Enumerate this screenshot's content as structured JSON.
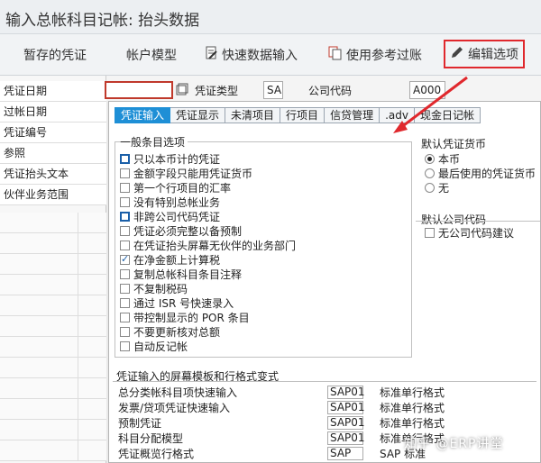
{
  "window": {
    "title": "输入总帐科目记帐: 抬头数据"
  },
  "toolbar": {
    "parked_label": "暂存的凭证",
    "account_model_label": "帐户模型",
    "fast_entry_label": "快速数据输入",
    "reference_label": "使用参考过账",
    "edit_options_label": "编辑选项"
  },
  "left_panel": {
    "items": [
      "凭证日期",
      "过帐日期",
      "凭证编号",
      "参照",
      "凭证抬头文本",
      "伙伴业务范围"
    ]
  },
  "header": {
    "doc_type_label": "凭证类型",
    "doc_type_value": "SA",
    "company_code_label": "公司代码",
    "company_code_value": "A000"
  },
  "dialog": {
    "tabs": [
      "凭证输入",
      "凭证显示",
      "未清项目",
      "行项目",
      "信贷管理",
      ".adv",
      "现金日记帐"
    ],
    "general_group_title": "一般条目选项",
    "general_options": [
      {
        "label": "只以本币计的凭证",
        "checked": false
      },
      {
        "label": "金额字段只能用凭证货币",
        "checked": false
      },
      {
        "label": "第一个行项目的汇率",
        "checked": false
      },
      {
        "label": "没有特别总帐业务",
        "checked": false
      },
      {
        "label": "非跨公司代码凭证",
        "checked": false
      },
      {
        "label": "凭证必须完整以备预制",
        "checked": false
      },
      {
        "label": "在凭证抬头屏幕无伙伴的业务部门",
        "checked": false
      },
      {
        "label": "在净金额上计算税",
        "checked": true
      },
      {
        "label": "复制总帐科目条目注释",
        "checked": false
      },
      {
        "label": "不复制税码",
        "checked": false
      },
      {
        "label": "通过 ISR 号快速录入",
        "checked": false
      },
      {
        "label": "带控制显示的 POR 条目",
        "checked": false
      },
      {
        "label": "不要更新核对总额",
        "checked": false
      },
      {
        "label": "自动反记帐",
        "checked": false
      }
    ],
    "currency_group_title": "默认凭证货币",
    "currency_options": [
      {
        "label": "本币",
        "selected": true
      },
      {
        "label": "最后使用的凭证货币",
        "selected": false
      },
      {
        "label": "无",
        "selected": false
      }
    ],
    "company_group_title": "默认公司代码",
    "company_option": "无公司代码建议",
    "templates_group_title": "凭证输入的屏幕模板和行格式变式",
    "templates": [
      {
        "name": "总分类帐科目项快速输入",
        "code": "SAP01",
        "format": "标准单行格式"
      },
      {
        "name": "发票/贷项凭证快速输入",
        "code": "SAP01",
        "format": "标准单行格式"
      },
      {
        "name": "预制凭证",
        "code": "SAP01",
        "format": "标准单行格式"
      },
      {
        "name": "科目分配模型",
        "code": "SAP01",
        "format": "标准单行格式"
      },
      {
        "name": "凭证概览行格式",
        "code": "SAP",
        "format": "SAP 标准"
      }
    ]
  },
  "watermark": "知乎 @ERP讲堂",
  "colors": {
    "active_tab": "#1e8fd6",
    "highlight": "#e0282d"
  }
}
